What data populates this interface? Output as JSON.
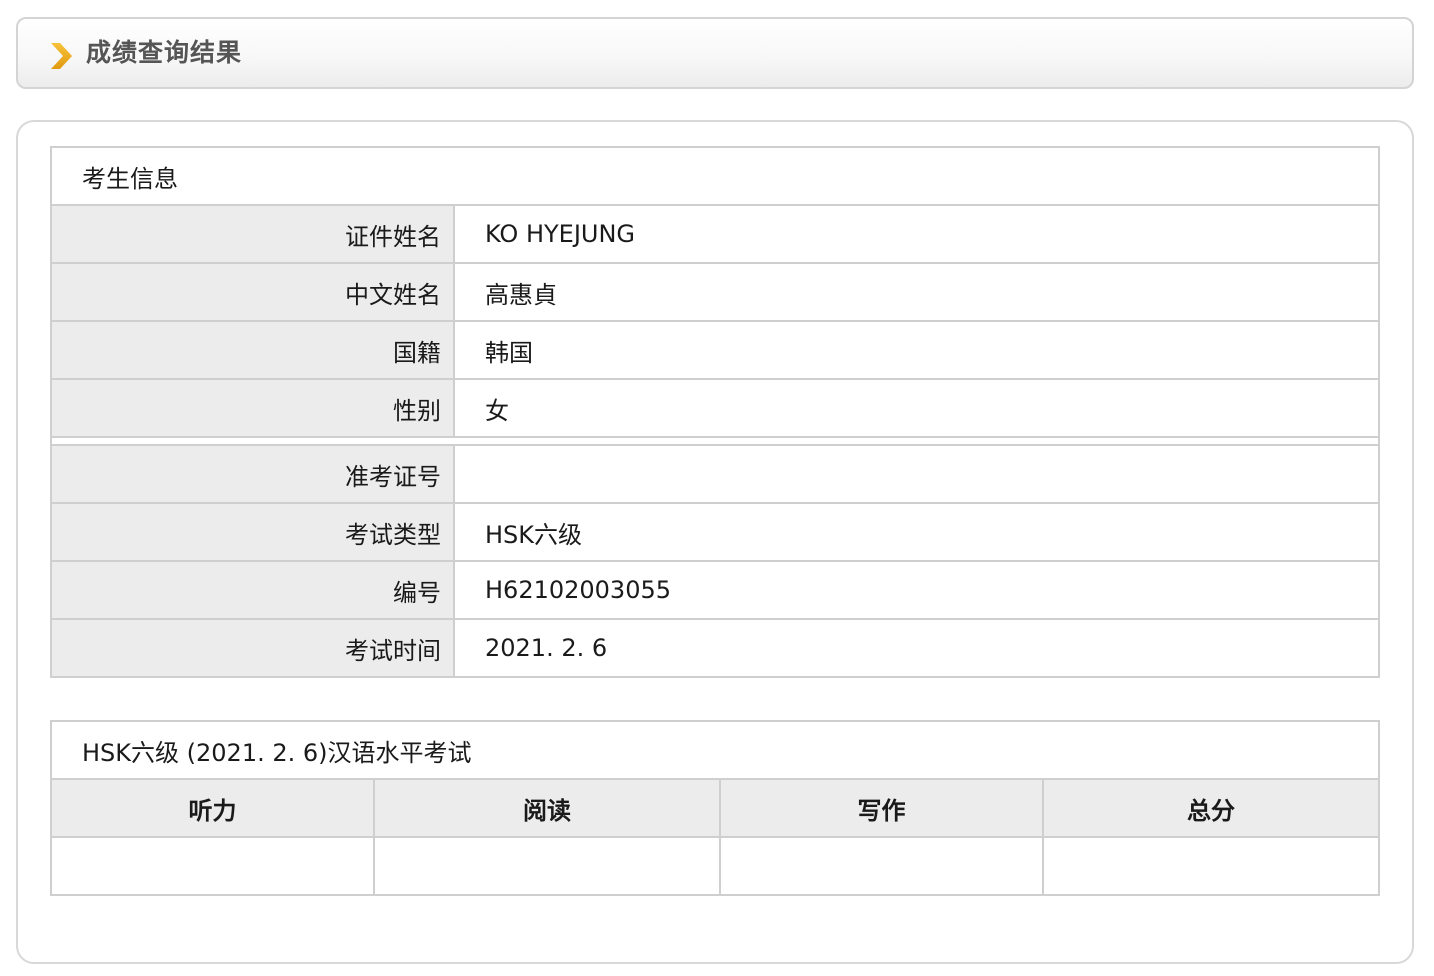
{
  "header": {
    "title": "成绩查询结果",
    "arrow_icon": "chevron-right-icon",
    "arrow_color": "#f0a818"
  },
  "candidate": {
    "section_title": "考生信息",
    "fields": [
      {
        "label": "证件姓名",
        "value": "KO HYEJUNG"
      },
      {
        "label": "中文姓名",
        "value": "高惠貞"
      },
      {
        "label": "国籍",
        "value": "韩国"
      },
      {
        "label": "性别",
        "value": "女"
      }
    ],
    "exam_fields": [
      {
        "label": "准考证号",
        "value": ""
      },
      {
        "label": "考试类型",
        "value": "HSK六级"
      },
      {
        "label": "编号",
        "value": "H62102003055"
      },
      {
        "label": "考试时间",
        "value": "2021. 2. 6"
      }
    ]
  },
  "scores": {
    "section_title": "HSK六级 (2021. 2. 6)汉语水平考试",
    "columns": [
      "听力",
      "阅读",
      "写作",
      "总分"
    ],
    "values": [
      "",
      "",
      "",
      ""
    ]
  }
}
